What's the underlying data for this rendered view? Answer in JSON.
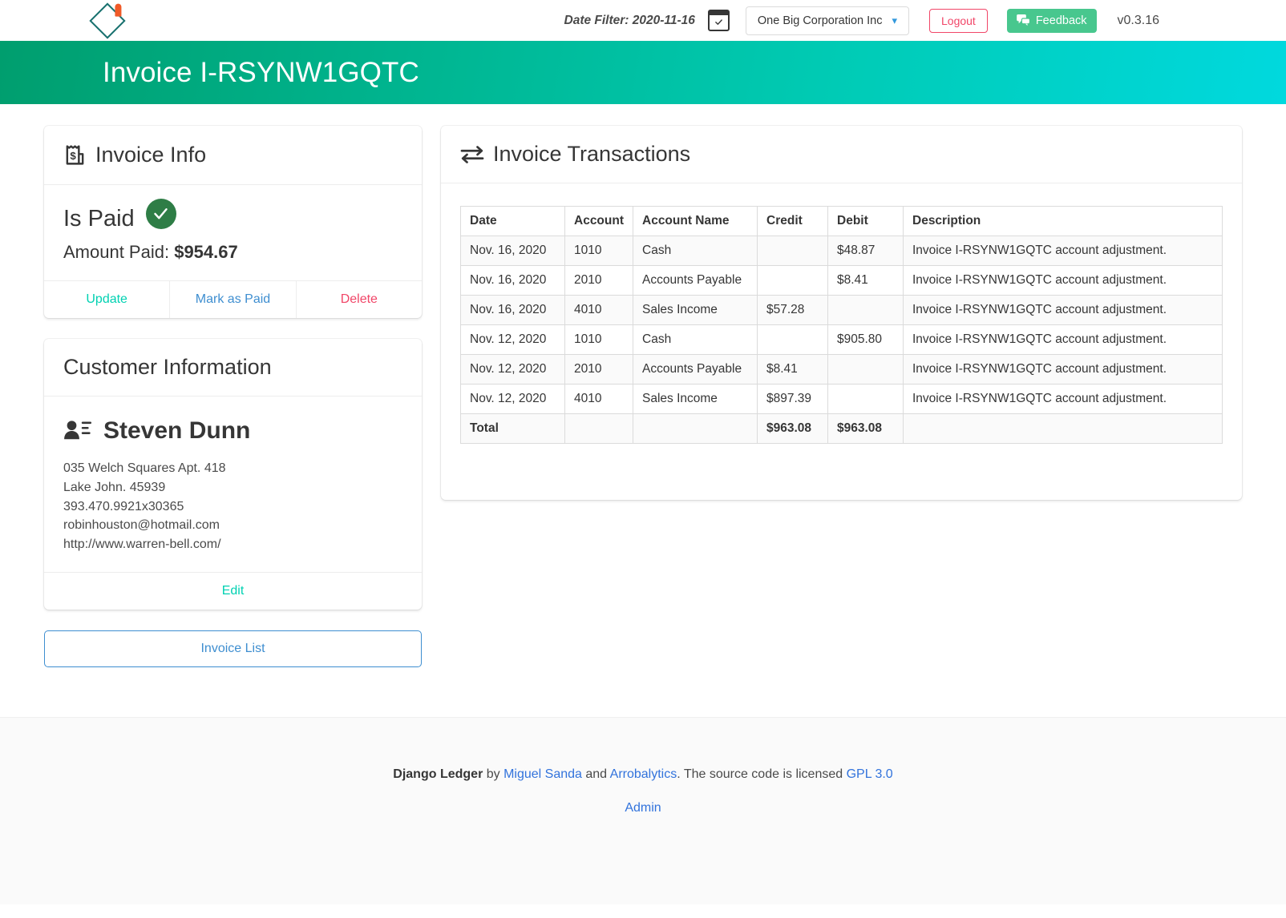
{
  "topnav": {
    "logo_name": "django-ledger-logo",
    "date_filter_label": "Date Filter: 2020-11-16",
    "calendar_icon": "calendar-check-icon",
    "company_select_value": "One Big Corporation Inc",
    "company_caret": "▾",
    "logout_label": "Logout",
    "feedback_label": "Feedback",
    "feedback_icon": "comments-icon",
    "feedback_color": "#48c78e",
    "version": "v0.3.16"
  },
  "hero": {
    "title": "Invoice I-RSYNW1GQTC",
    "gradient_from": "#009e6e",
    "gradient_to": "#00d9de"
  },
  "invoice_info": {
    "icon": "receipt-dollar-icon",
    "title": "Invoice Info",
    "is_paid_label": "Is Paid",
    "is_paid_badge_icon": "check-circle-icon",
    "is_paid_badge_color": "#2e7d46",
    "amount_paid_label": "Amount Paid:",
    "amount_paid_value": "$954.67",
    "actions": [
      {
        "label": "Update",
        "color": "#00d1b2"
      },
      {
        "label": "Mark as Paid",
        "color": "#3e8ed0"
      },
      {
        "label": "Delete",
        "color": "#f14668"
      }
    ]
  },
  "customer": {
    "title": "Customer Information",
    "icon": "contact-card-icon",
    "name": "Steven Dunn",
    "lines": [
      "035 Welch Squares Apt. 418",
      "Lake John. 45939",
      "393.470.9921x30365",
      "robinhouston@hotmail.com",
      "http://www.warren-bell.com/"
    ],
    "edit_label": "Edit"
  },
  "invoice_list_button": "Invoice List",
  "transactions": {
    "icon": "exchange-arrows-icon",
    "title": "Invoice Transactions",
    "columns": [
      "Date",
      "Account",
      "Account Name",
      "Credit",
      "Debit",
      "Description"
    ],
    "rows": [
      {
        "date": "Nov. 16, 2020",
        "account": "1010",
        "account_name": "Cash",
        "credit": "",
        "debit": "$48.87",
        "description": "Invoice I-RSYNW1GQTC account adjustment."
      },
      {
        "date": "Nov. 16, 2020",
        "account": "2010",
        "account_name": "Accounts Payable",
        "credit": "",
        "debit": "$8.41",
        "description": "Invoice I-RSYNW1GQTC account adjustment."
      },
      {
        "date": "Nov. 16, 2020",
        "account": "4010",
        "account_name": "Sales Income",
        "credit": "$57.28",
        "debit": "",
        "description": "Invoice I-RSYNW1GQTC account adjustment."
      },
      {
        "date": "Nov. 12, 2020",
        "account": "1010",
        "account_name": "Cash",
        "credit": "",
        "debit": "$905.80",
        "description": "Invoice I-RSYNW1GQTC account adjustment."
      },
      {
        "date": "Nov. 12, 2020",
        "account": "2010",
        "account_name": "Accounts Payable",
        "credit": "$8.41",
        "debit": "",
        "description": "Invoice I-RSYNW1GQTC account adjustment."
      },
      {
        "date": "Nov. 12, 2020",
        "account": "4010",
        "account_name": "Sales Income",
        "credit": "$897.39",
        "debit": "",
        "description": "Invoice I-RSYNW1GQTC account adjustment."
      }
    ],
    "total": {
      "label": "Total",
      "account": "",
      "account_name": "",
      "credit": "$963.08",
      "debit": "$963.08",
      "description": ""
    }
  },
  "footer": {
    "brand": "Django Ledger",
    "by": " by ",
    "author": "Miguel Sanda",
    "and": " and ",
    "org": "Arrobalytics",
    "license_text": ". The source code is licensed ",
    "license": "GPL 3.0",
    "admin": "Admin"
  }
}
